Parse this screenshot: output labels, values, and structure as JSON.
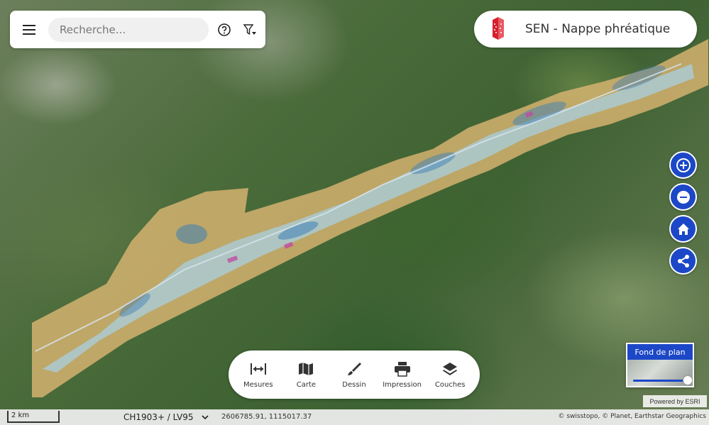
{
  "search": {
    "placeholder": "Recherche..."
  },
  "header": {
    "title": "SEN - Nappe phréatique"
  },
  "controls": {
    "zoom_in": "plus-icon",
    "zoom_out": "minus-icon",
    "home": "home-icon",
    "share": "share-icon",
    "accent_color": "#1c47c7"
  },
  "toolbar": {
    "items": [
      {
        "label": "Mesures",
        "icon": "measure-icon"
      },
      {
        "label": "Carte",
        "icon": "map-icon"
      },
      {
        "label": "Dessin",
        "icon": "brush-icon"
      },
      {
        "label": "Impression",
        "icon": "print-icon"
      },
      {
        "label": "Couches",
        "icon": "layers-icon"
      }
    ]
  },
  "basemap": {
    "label": "Fond de plan",
    "opacity_fraction": 0.95
  },
  "powered_by": "Powered by ESRI",
  "status": {
    "scale_label": "2 km",
    "crs_selected": "CH1903+ / LV95",
    "coordinates": "2606785.91, 1115017.37",
    "attribution": "© swisstopo, © Planet, Earthstar Geographics"
  },
  "overlay_colors": {
    "sand": "#d9b472",
    "light_blue": "#a8cfe0",
    "blue": "#3d7fb8",
    "magenta": "#c04ba0"
  }
}
